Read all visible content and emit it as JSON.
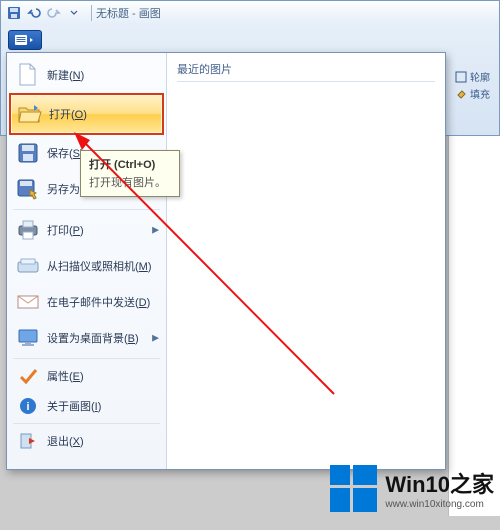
{
  "title": "无标题 - 画图",
  "ribbon_right": {
    "outline": "轮廓",
    "fill": "填充"
  },
  "menu": {
    "recent_header": "最近的图片",
    "items": {
      "new": "新建(N)",
      "open": "打开(O)",
      "save": "保存(S)",
      "saveas": "另存为(A)",
      "print": "打印(P)",
      "scanner": "从扫描仪或照相机(M)",
      "email": "在电子邮件中发送(D)",
      "wallpaper": "设置为桌面背景(B)",
      "properties": "属性(E)",
      "about": "关于画图(I)",
      "exit": "退出(X)"
    }
  },
  "tooltip": {
    "title": "打开 (Ctrl+O)",
    "body": "打开现有图片。"
  },
  "watermark": {
    "brand": "Win10之家",
    "url": "www.win10xitong.com"
  }
}
